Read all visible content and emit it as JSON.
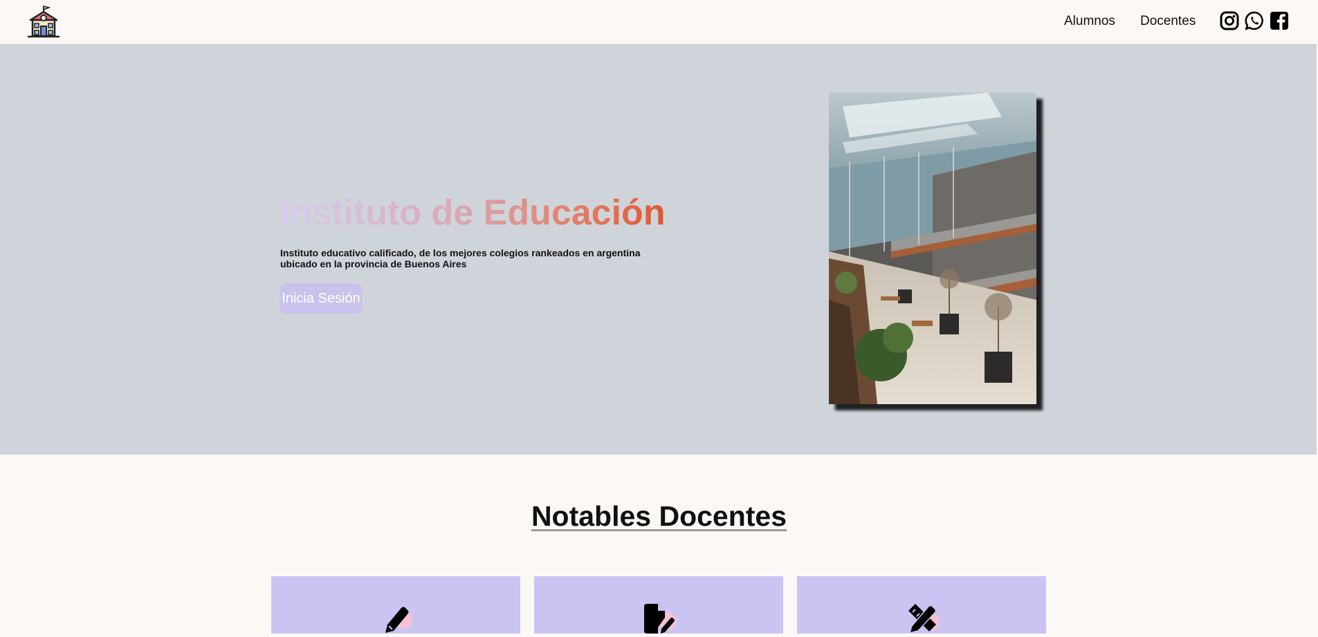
{
  "nav": {
    "links": [
      "Alumnos",
      "Docentes"
    ],
    "social_icons": [
      "instagram-icon",
      "whatsapp-icon",
      "facebook-icon"
    ]
  },
  "hero": {
    "title": "Instituto de Educación",
    "subtitle": "Instituto educativo calificado, de los mejores colegios rankeados en argentina ubicado en la provincia de Buenos Aires",
    "login_label": "Inicia Sesión"
  },
  "section": {
    "title": "Notables Docentes"
  },
  "cards": [
    {
      "icon": "pencil-icon"
    },
    {
      "icon": "file-pen-icon"
    },
    {
      "icon": "pencil-ruler-icon"
    }
  ],
  "colors": {
    "hero_bg": "#cfd4da",
    "card_bg": "#cac4f2",
    "button_bg": "#c9c2ec",
    "title_gradient_start": "#d8cdf2",
    "title_gradient_end": "#e2562c"
  }
}
